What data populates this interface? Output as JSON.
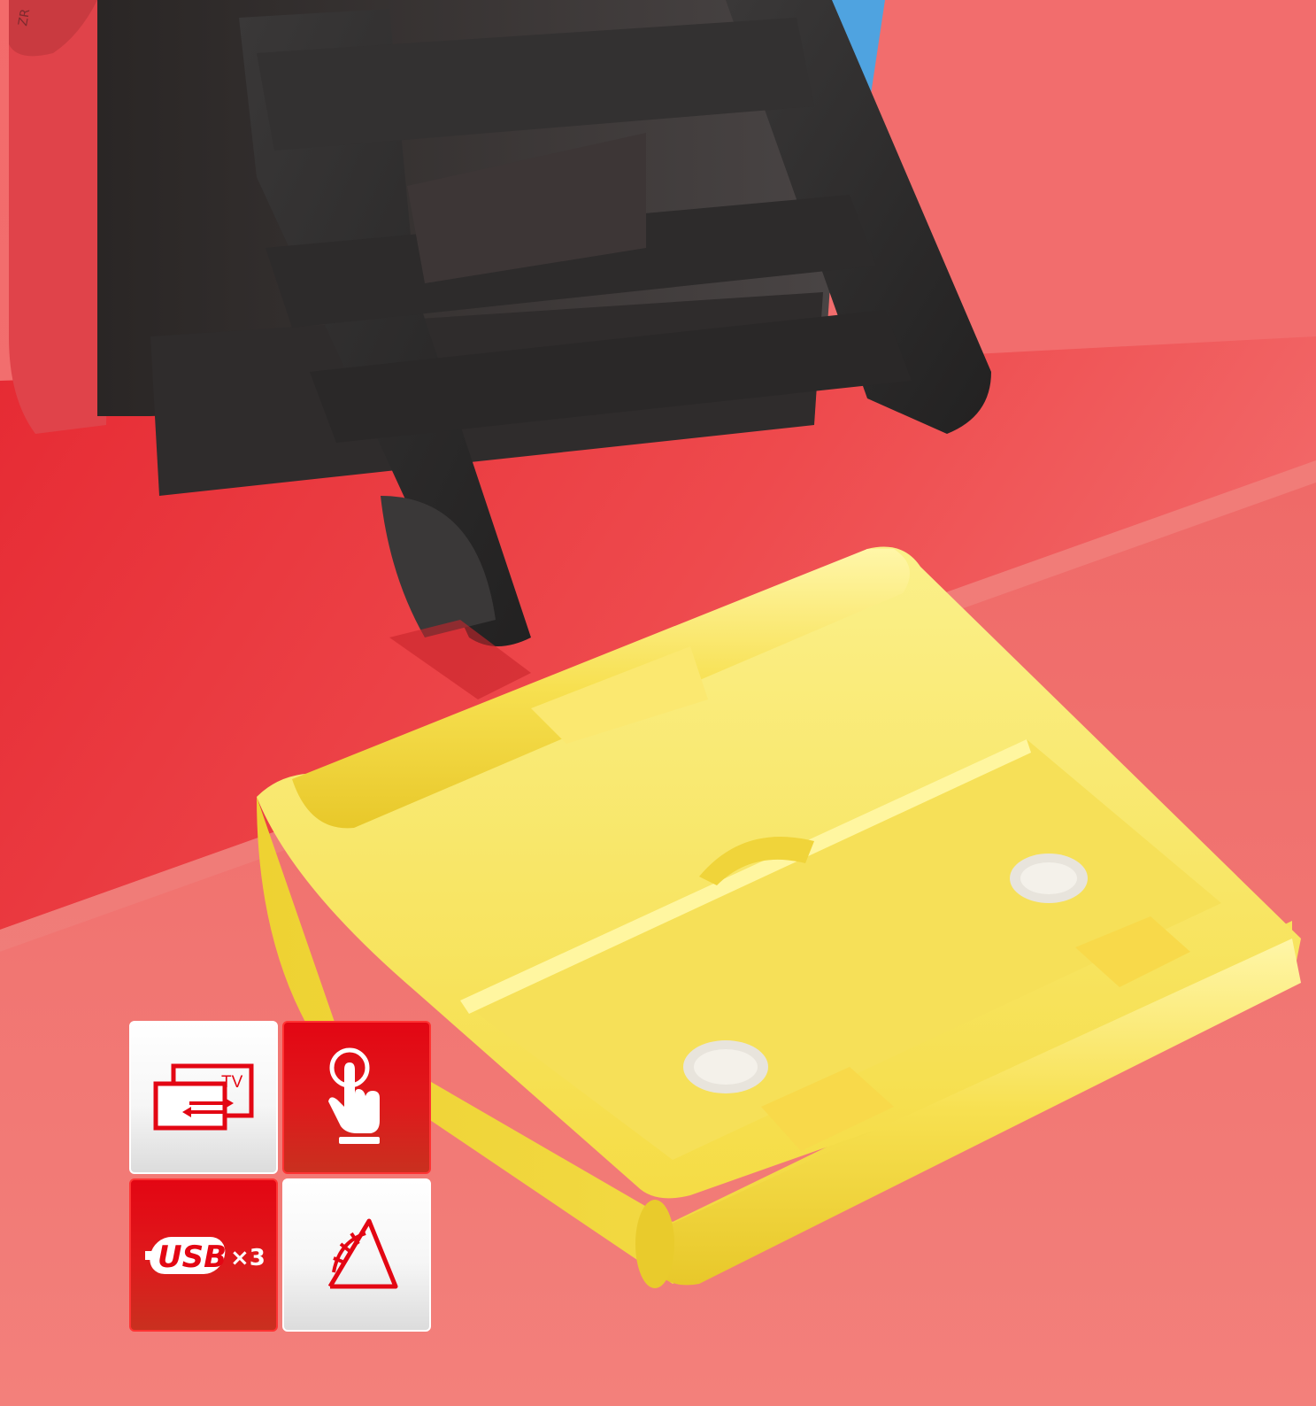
{
  "scene": {
    "description_colors": {
      "background": "#f07070",
      "surface_red": "#e8323a",
      "stand_dark": "#2b2b2b",
      "dock_yellow": "#f7e04a",
      "console_left": "#e0434a",
      "console_right": "#4fa3e0"
    }
  },
  "features": [
    {
      "icon": "tv-output-icon",
      "label": "TV"
    },
    {
      "icon": "touch-icon",
      "label": ""
    },
    {
      "icon": "usb-icon",
      "label": "USB",
      "multiplier": "×3"
    },
    {
      "icon": "adjustable-angle-icon",
      "label": ""
    }
  ],
  "console_marking": "ZR"
}
